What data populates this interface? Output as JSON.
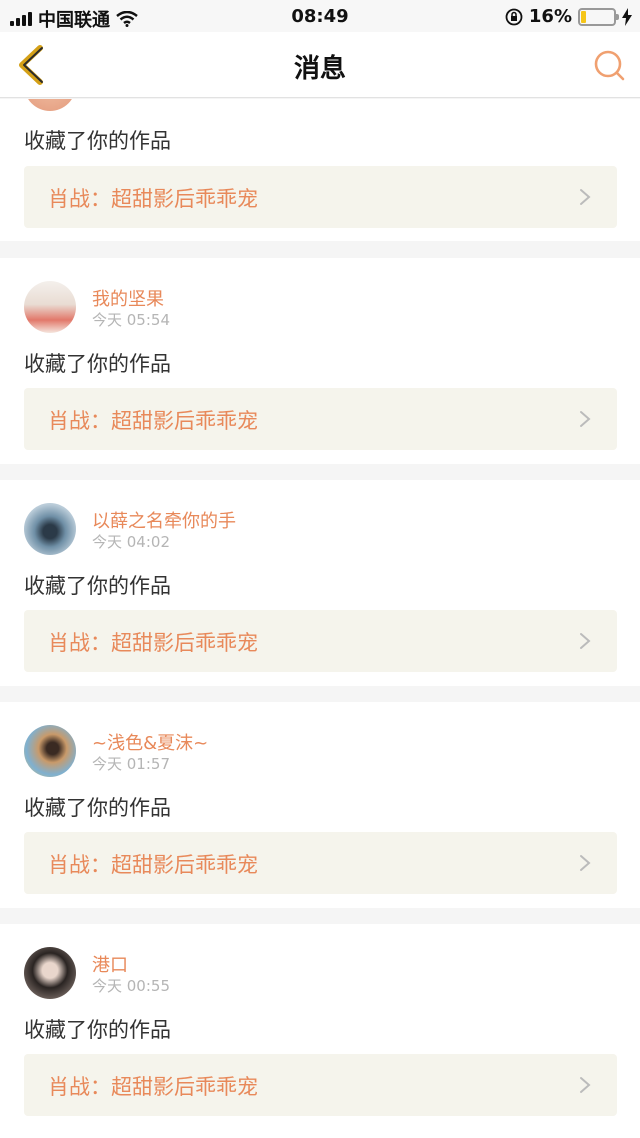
{
  "status_bar": {
    "carrier": "中国联通",
    "time": "08:49",
    "battery_percent": "16%",
    "battery_level": 0.16
  },
  "nav": {
    "title": "消息"
  },
  "partial_item": {
    "action": "收藏了你的作品",
    "work_title": "肖战：超甜影后乖乖宠"
  },
  "messages": [
    {
      "username": "我的坚果",
      "time": "今天 05:54",
      "action": "收藏了你的作品",
      "work_title": "肖战：超甜影后乖乖宠"
    },
    {
      "username": "以薛之名牵你的手",
      "time": "今天 04:02",
      "action": "收藏了你的作品",
      "work_title": "肖战：超甜影后乖乖宠"
    },
    {
      "username": "~浅色&夏沫~",
      "time": "今天 01:57",
      "action": "收藏了你的作品",
      "work_title": "肖战：超甜影后乖乖宠"
    },
    {
      "username": "港口",
      "time": "今天 00:55",
      "action": "收藏了你的作品",
      "work_title": "肖战：超甜影后乖乖宠"
    }
  ],
  "colors": {
    "accent": "#e8895a",
    "nav_back": "#d4a017"
  }
}
